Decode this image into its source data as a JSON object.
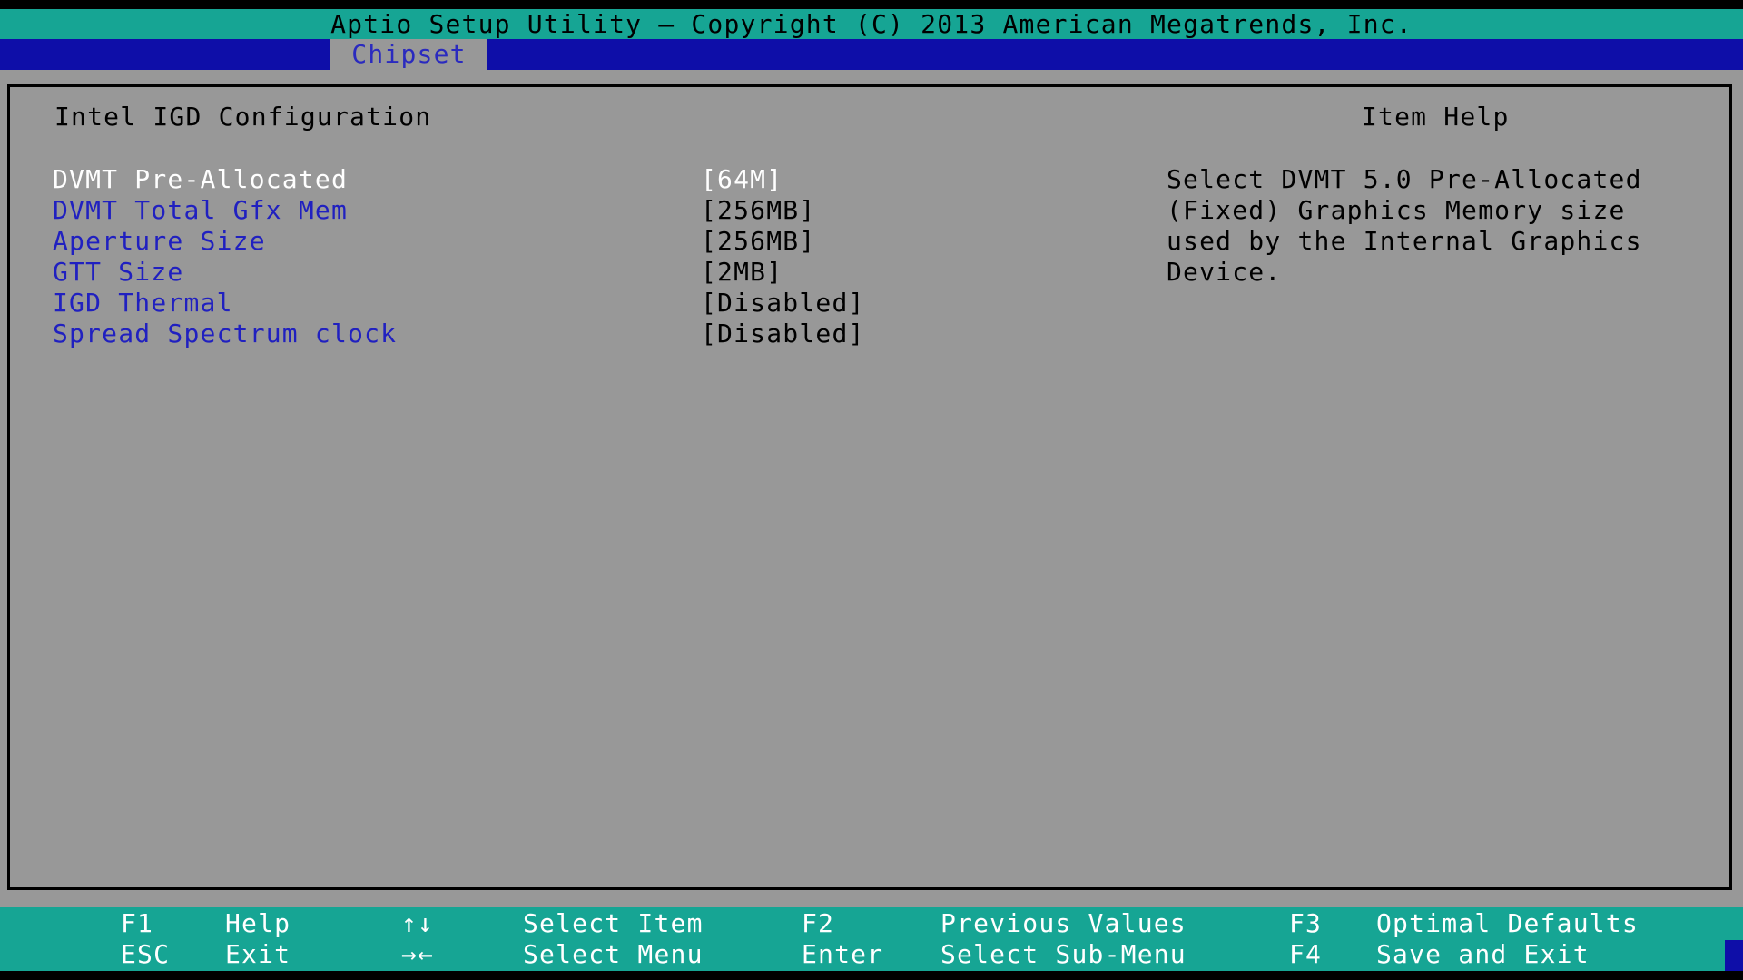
{
  "header": {
    "title": "Aptio Setup Utility – Copyright (C) 2013 American Megatrends, Inc."
  },
  "menu": {
    "tabs": [
      {
        "label": "Chipset"
      }
    ]
  },
  "page": {
    "heading": "Intel IGD Configuration",
    "help_heading": "Item Help",
    "items": [
      {
        "label": "DVMT Pre-Allocated",
        "value": "[64M]"
      },
      {
        "label": "DVMT Total Gfx Mem",
        "value": "[256MB]"
      },
      {
        "label": "Aperture Size",
        "value": "[256MB]"
      },
      {
        "label": "GTT Size",
        "value": "[2MB]"
      },
      {
        "label": "IGD Thermal",
        "value": "[Disabled]"
      },
      {
        "label": "Spread Spectrum clock",
        "value": "[Disabled]"
      }
    ],
    "help_lines": [
      "Select DVMT 5.0 Pre-Allocated",
      "(Fixed) Graphics Memory size",
      "used by the Internal Graphics",
      "Device."
    ]
  },
  "footer": {
    "keys": [
      {
        "key": "F1",
        "action": "Help"
      },
      {
        "key": "ESC",
        "action": "Exit"
      },
      {
        "key": "↑↓",
        "action": "Select Item"
      },
      {
        "key": "→←",
        "action": "Select Menu"
      },
      {
        "key": "F2",
        "action": "Previous Values"
      },
      {
        "key": "Enter",
        "action": "Select Sub-Menu"
      },
      {
        "key": "F3",
        "action": "Optimal Defaults"
      },
      {
        "key": "F4",
        "action": "Save and Exit"
      }
    ]
  }
}
